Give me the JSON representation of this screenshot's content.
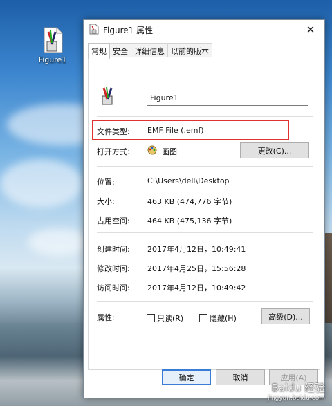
{
  "desktop": {
    "icon_label": "Figure1"
  },
  "dialog": {
    "title": "Figure1 属性",
    "tabs": [
      "常规",
      "安全",
      "详细信息",
      "以前的版本"
    ],
    "file_name": "Figure1",
    "file_type_label": "文件类型:",
    "file_type_value": "EMF File (.emf)",
    "open_with_label": "打开方式:",
    "open_with_value": "画图",
    "change_button": "更改(C)...",
    "location_label": "位置:",
    "location_value": "C:\\Users\\dell\\Desktop",
    "size_label": "大小:",
    "size_value": "463 KB (474,776 字节)",
    "disk_size_label": "占用空间:",
    "disk_size_value": "464 KB (475,136 字节)",
    "created_label": "创建时间:",
    "created_value": "2017年4月12日，10:49:41",
    "modified_label": "修改时间:",
    "modified_value": "2017年4月25日，15:56:28",
    "accessed_label": "访问时间:",
    "accessed_value": "2017年4月12日，10:49:42",
    "attributes_label": "属性:",
    "readonly_label": "只读(R)",
    "hidden_label": "隐藏(H)",
    "advanced_button": "高级(D)...",
    "ok_button": "确定",
    "cancel_button": "取消",
    "apply_button": "应用(A)"
  },
  "watermark": {
    "main": "Baidu 经验",
    "sub": "jingyan.baidu.com"
  }
}
